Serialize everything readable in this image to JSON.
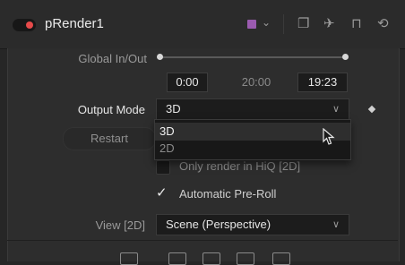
{
  "header": {
    "title": "pRender1",
    "swatch_color": "#9b5bb0",
    "icons": [
      "power-toggle-icon",
      "color-swatch-icon",
      "chevron-down-icon",
      "versions-icon",
      "pin-icon",
      "lock-icon",
      "reset-icon"
    ]
  },
  "global_in_out": {
    "label": "Global In/Out",
    "start": "0:00",
    "mid": "20:00",
    "end": "19:23"
  },
  "output_mode": {
    "label": "Output Mode",
    "value": "3D",
    "options": [
      "3D",
      "2D"
    ],
    "highlighted": "3D"
  },
  "restart_label": "Restart",
  "only_render_hiq": {
    "label": "Only render in HiQ [2D]",
    "checked": false
  },
  "auto_preroll": {
    "label": "Automatic Pre-Roll",
    "checked": true,
    "check_glyph": "✓"
  },
  "view": {
    "label": "View [2D]",
    "value": "Scene (Perspective)"
  },
  "bottom_tools": [
    "tool-tab-1-icon",
    "tool-tab-2-icon",
    "tool-tab-3-icon",
    "tool-tab-4-icon",
    "tool-tab-5-icon"
  ]
}
